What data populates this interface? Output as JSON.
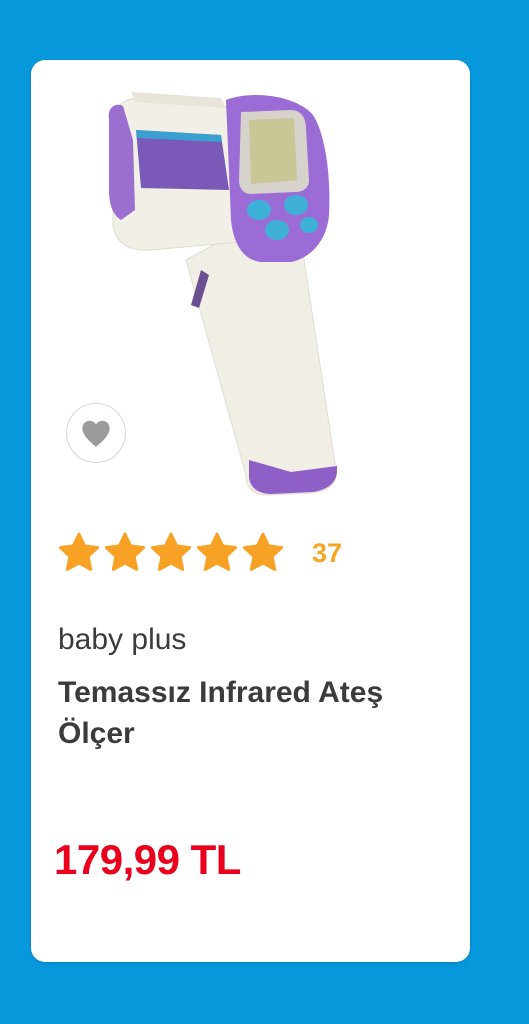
{
  "product": {
    "image_alt": "infrared thermometer",
    "rating_value": 5,
    "rating_max": 5,
    "review_count": "37",
    "brand": "baby plus",
    "title": "Temassız Infrared Ateş Ölçer",
    "price": "179,99 TL"
  },
  "icons": {
    "favorite": "heart-icon",
    "star": "star-icon"
  },
  "colors": {
    "background": "#0797db",
    "star": "#f7a225",
    "price": "#e8001c",
    "review_count": "#f5a623"
  }
}
